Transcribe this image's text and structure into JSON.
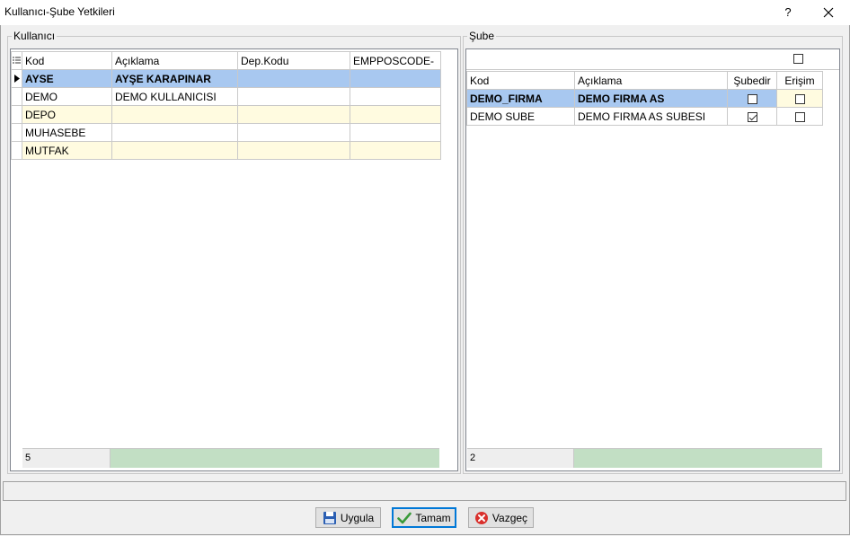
{
  "window": {
    "title": "Kullanıcı-Şube Yetkileri",
    "help_label": "?"
  },
  "kullanici": {
    "legend": "Kullanıcı",
    "columns": [
      "Kod",
      "Açıklama",
      "Dep.Kodu",
      "EMPPOSCODE-"
    ],
    "rows": [
      {
        "kod": "AYSE",
        "aciklama": "AYŞE KARAPINAR",
        "dep": "",
        "emp": ""
      },
      {
        "kod": "DEMO",
        "aciklama": "DEMO KULLANICISI",
        "dep": "",
        "emp": ""
      },
      {
        "kod": "DEPO",
        "aciklama": "",
        "dep": "",
        "emp": ""
      },
      {
        "kod": "MUHASEBE",
        "aciklama": "",
        "dep": "",
        "emp": ""
      },
      {
        "kod": "MUTFAK",
        "aciklama": "",
        "dep": "",
        "emp": ""
      }
    ],
    "count": "5"
  },
  "sube": {
    "legend": "Şube",
    "columns": [
      "Kod",
      "Açıklama",
      "Şubedir",
      "Erişim"
    ],
    "rows": [
      {
        "kod": "DEMO_FIRMA",
        "aciklama": "DEMO FIRMA AS",
        "subedir": false,
        "erisim": false
      },
      {
        "kod": "DEMO SUBE",
        "aciklama": "DEMO FIRMA AS SUBESI",
        "subedir": true,
        "erisim": false
      }
    ],
    "select_all": false,
    "count": "2"
  },
  "buttons": {
    "apply": "Uygula",
    "ok": "Tamam",
    "cancel": "Vazgeç"
  },
  "colors": {
    "selected_row": "#a8c8f0",
    "alt_row": "#fffbe0",
    "footer_fill": "#c2dfc4",
    "default_button_border": "#0078d7"
  }
}
